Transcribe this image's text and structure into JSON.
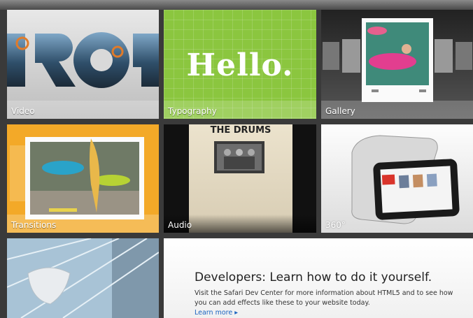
{
  "tiles": {
    "video": {
      "label": "Video"
    },
    "typography": {
      "label": "Typography",
      "display_text": "Hello."
    },
    "gallery": {
      "label": "Gallery"
    },
    "transitions": {
      "label": "Transitions"
    },
    "audio": {
      "label": "Audio",
      "album_text": "THE DRUMS"
    },
    "rotation": {
      "label": "360°"
    }
  },
  "developers": {
    "title": "Developers: Learn how to do it yourself.",
    "body": "Visit the Safari Dev Center for more information about HTML5 and to see how you can add effects like these to your website today.",
    "link": "Learn more ▸"
  },
  "colors": {
    "typography_green": "#8bc63f",
    "transitions_orange": "#f3a928",
    "link_blue": "#1a64c0"
  }
}
